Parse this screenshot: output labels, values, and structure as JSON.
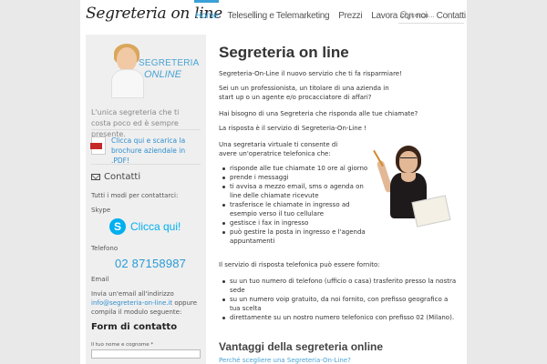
{
  "header": {
    "logo": "Segreteria on line",
    "nav": [
      "Home",
      "Teleselling e Telemarketing",
      "Prezzi",
      "Lavora con noi",
      "Contatti"
    ],
    "active_nav": "Home",
    "search_placeholder": "cerca..."
  },
  "sidebar": {
    "logo_line1": "SEGRETERIA",
    "logo_line2": "ONLINE",
    "tagline": "L'unica segreteria che ti costa poco ed è sempre presente.",
    "pdf_link": "Clicca qui e scarica la brochure aziendale in .PDF!",
    "contact": {
      "title": "Contatti",
      "intro": "Tutti i modi per contattarci:",
      "skype_label": "Skype",
      "skype_button": "Clicca qui!",
      "phone_label": "Telefono",
      "phone": "02 87158987",
      "email_label": "Email",
      "email_text_pre": "Invia un'email all'indirizzo",
      "email_address": "info@segreteria-on-line.it",
      "email_text_post": "oppure compila il modulo seguente:",
      "form_title": "Form di contatto",
      "name_label": "Il tuo nome e cognome *"
    }
  },
  "main": {
    "title": "Segreteria on line",
    "p1": "Segreteria-On-Line il nuovo servizio che ti fa risparmiare!",
    "p2": "Sei un un professionista, un titolare di una azienda in start up o  un agente e/o procacciatore di affari?",
    "p3": "Hai bisogno di una Segreteria che risponda alle tue chiamate?",
    "p4": "La risposta è il servizio di Segreteria-On-Line !",
    "p5": "Una segretaria virtuale ti  consente di avere un'operatrice telefonica che:",
    "list1": [
      "risponde alle tue  chiamate 10 ore al giorno",
      "prende i messaggi",
      "ti avvisa a mezzo email, sms o agenda on line delle chiamate  ricevute",
      "trasferisce le chiamate in ingresso ad esempio verso il tuo cellulare",
      "gestisce i fax in ingresso",
      "può gestire la posta in ingresso e l'agenda appuntamenti"
    ],
    "p6": "Il servizio di risposta telefonica può essere fornito:",
    "list2": [
      "su un tuo numero di telefono (ufficio o casa) trasferito presso la nostra sede",
      "su un numero voip gratuito, da noi fornito, con prefisso geografico  a tua scelta",
      "direttamente su un nostro numero telefonico con prefisso  02 (Milano)."
    ],
    "h2": "Vantaggi della segreteria online",
    "cut": "Perché scegliere una Segreteria-On-Line?"
  },
  "colors": {
    "accent": "#3aa0d8",
    "skype": "#00aff0",
    "sidebar_bg": "#efefef",
    "page_bg": "#e9e9e9"
  }
}
